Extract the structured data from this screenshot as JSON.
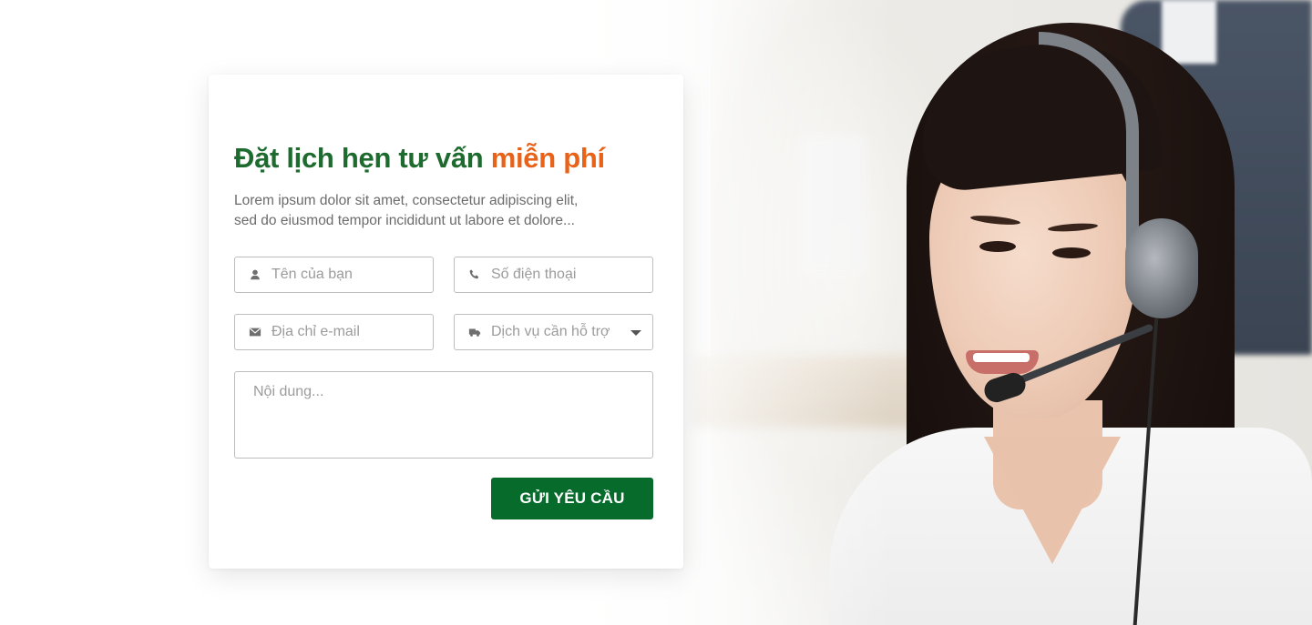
{
  "form": {
    "title_main": "Đặt lịch hẹn tư vấn",
    "title_accent": "miễn phí",
    "description_line1": "Lorem ipsum dolor sit amet, consectetur adipiscing elit,",
    "description_line2": "sed do eiusmod tempor incididunt ut labore et dolore...",
    "name_placeholder": "Tên của bạn",
    "phone_placeholder": "Số điện thoại",
    "email_placeholder": "Địa chỉ e-mail",
    "service_placeholder": "Dịch vụ cần hỗ trợ",
    "message_placeholder": "Nội dung...",
    "submit_label": "GỬI YÊU CẦU"
  },
  "icons": {
    "name": "user-icon",
    "phone": "phone-icon",
    "email": "envelope-icon",
    "service": "truck-icon",
    "service_dropdown": "caret-down-icon"
  },
  "colors": {
    "title_green": "#1e6b2f",
    "accent_orange": "#e8621a",
    "button_green": "#076b2c"
  }
}
